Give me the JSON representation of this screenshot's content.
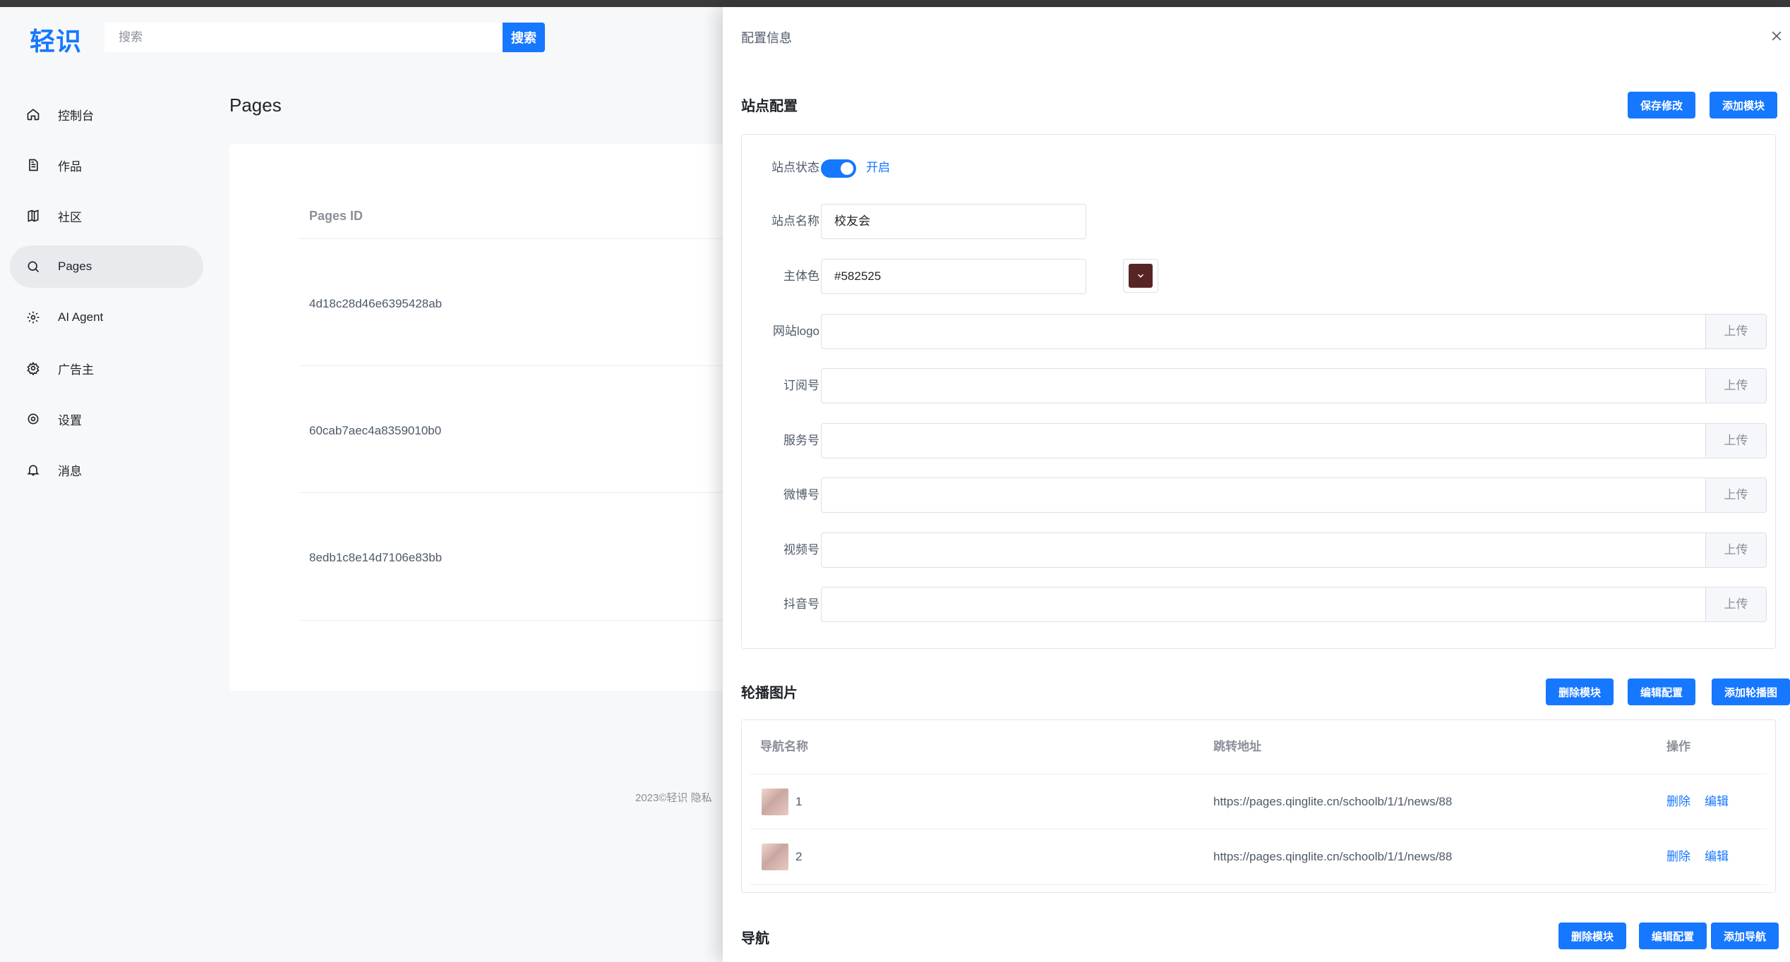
{
  "app": {
    "logo": "轻识"
  },
  "search": {
    "placeholder": "搜索",
    "button": "搜索"
  },
  "sidebar": {
    "items": [
      {
        "label": "控制台",
        "icon": "home-icon"
      },
      {
        "label": "作品",
        "icon": "document-icon"
      },
      {
        "label": "社区",
        "icon": "book-icon"
      },
      {
        "label": "Pages",
        "icon": "search-icon",
        "active": true
      },
      {
        "label": "AI Agent",
        "icon": "gear-icon"
      },
      {
        "label": "广告主",
        "icon": "settings-cog-icon"
      },
      {
        "label": "设置",
        "icon": "circle-settings-icon"
      },
      {
        "label": "消息",
        "icon": "bell-icon"
      }
    ]
  },
  "main": {
    "title": "Pages",
    "table": {
      "header": "Pages ID",
      "rows": [
        "4d18c28d46e6395428ab",
        "60cab7aec4a8359010b0",
        "8edb1c8e14d7106e83bb"
      ]
    },
    "footer": "2023©轻识    隐私"
  },
  "drawer": {
    "title": "配置信息",
    "site": {
      "title": "站点配置",
      "save_button": "保存修改",
      "add_module_button": "添加模块",
      "status_label": "站点状态",
      "status_value": "开启",
      "name_label": "站点名称",
      "name_value": "校友会",
      "color_label": "主体色",
      "color_value": "#582525",
      "upload_label": "上传",
      "uploads": [
        {
          "label": "网站logo",
          "value": ""
        },
        {
          "label": "订阅号",
          "value": ""
        },
        {
          "label": "服务号",
          "value": ""
        },
        {
          "label": "微博号",
          "value": ""
        },
        {
          "label": "视频号",
          "value": ""
        },
        {
          "label": "抖音号",
          "value": ""
        }
      ]
    },
    "carousel": {
      "title": "轮播图片",
      "delete_button": "删除模块",
      "edit_button": "编辑配置",
      "add_button": "添加轮播图",
      "columns": [
        "导航名称",
        "跳转地址",
        "操作"
      ],
      "rows": [
        {
          "name": "1",
          "url": "https://pages.qinglite.cn/schoolb/1/1/news/88"
        },
        {
          "name": "2",
          "url": "https://pages.qinglite.cn/schoolb/1/1/news/88"
        }
      ],
      "delete_link": "删除",
      "edit_link": "编辑"
    },
    "nav": {
      "title": "导航",
      "delete_button": "删除模块",
      "edit_button": "编辑配置",
      "add_button": "添加导航"
    }
  },
  "colors": {
    "accent": "#1677ff",
    "brand_swatch": "#582525"
  }
}
